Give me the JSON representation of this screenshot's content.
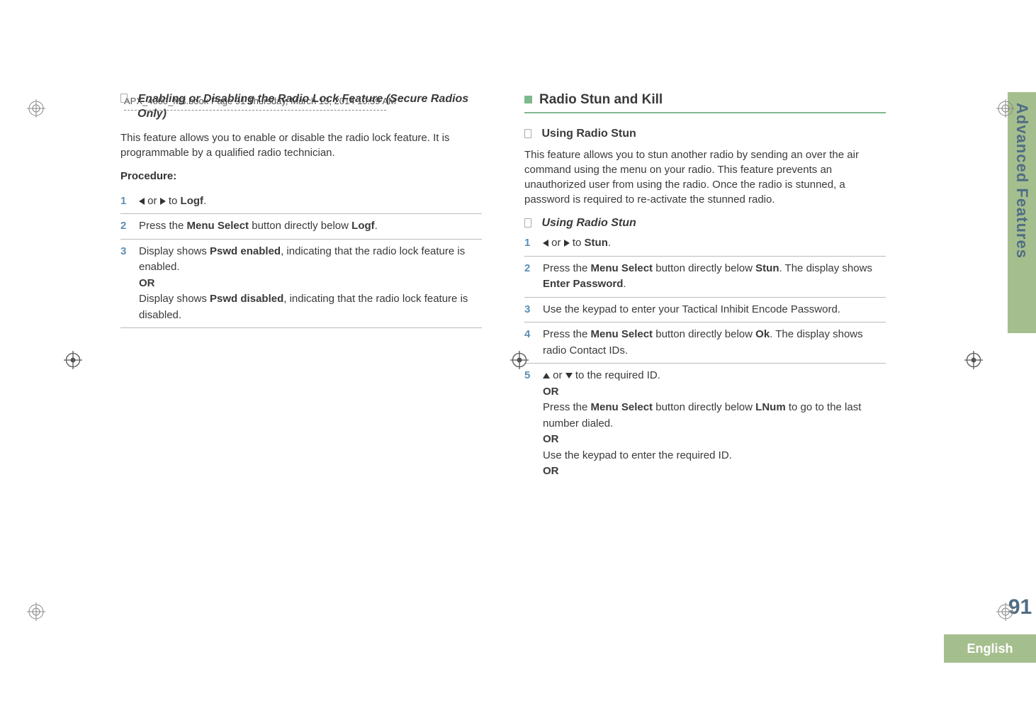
{
  "header": {
    "running_head": "APX_4000_M3.book  Page 91  Thursday, March 13, 2014  10:59 AM"
  },
  "side_tab": {
    "label": "Advanced Features"
  },
  "page_number": "91",
  "language": "English",
  "left_col": {
    "heading": "Enabling or Disabling the Radio Lock Feature (Secure Radios Only)",
    "intro": "This feature allows you to enable or disable the radio lock feature. It is programmable by a qualified radio technician.",
    "procedure_label": "Procedure:",
    "steps": [
      {
        "num": "1",
        "pre": "",
        "arrows": "lr",
        "mid": " to ",
        "ui": "Logf",
        "post": "."
      },
      {
        "num": "2",
        "pre": "Press the ",
        "bold1": "Menu Select",
        "mid": " button directly below ",
        "ui": "Logf",
        "post": "."
      },
      {
        "num": "3",
        "line1_pre": "Display shows ",
        "line1_ui": "Pswd enabled",
        "line1_post": ", indicating that the radio lock feature is enabled.",
        "or": "OR",
        "line2_pre": "Display shows ",
        "line2_ui": "Pswd disabled",
        "line2_post": ", indicating that the radio lock feature is disabled."
      }
    ]
  },
  "right_col": {
    "main_heading": "Radio Stun and Kill",
    "sub_heading": "Using Radio Stun",
    "intro": "This feature allows you to stun another radio by sending an over the air command using the menu on your radio. This feature prevents an unauthorized user from using the radio. Once the radio is stunned, a password is required to re-activate the stunned radio.",
    "sub_heading2": "Using Radio Stun",
    "steps": [
      {
        "num": "1",
        "arrows": "lr",
        "mid": " to ",
        "ui": "Stun",
        "post": "."
      },
      {
        "num": "2",
        "pre": "Press the ",
        "bold1": "Menu Select",
        "mid1": " button directly below ",
        "ui1": "Stun",
        "mid2": ". The display shows ",
        "ui2": "Enter Password",
        "post": "."
      },
      {
        "num": "3",
        "text": "Use the keypad to enter your Tactical Inhibit Encode Password."
      },
      {
        "num": "4",
        "pre": "Press the ",
        "bold1": "Menu Select",
        "mid1": " button directly below ",
        "ui1": "Ok",
        "post": ". The display shows radio Contact IDs."
      },
      {
        "num": "5",
        "arrows": "ud",
        "mid": " to the required ID.",
        "or1": "OR",
        "line2_pre": "Press the ",
        "line2_bold": "Menu Select",
        "line2_mid": " button directly below ",
        "line2_ui": "LNum",
        "line2_post": " to go to the last number dialed.",
        "or2": "OR",
        "line3": "Use the keypad to enter the required ID.",
        "or3": "OR"
      }
    ]
  }
}
